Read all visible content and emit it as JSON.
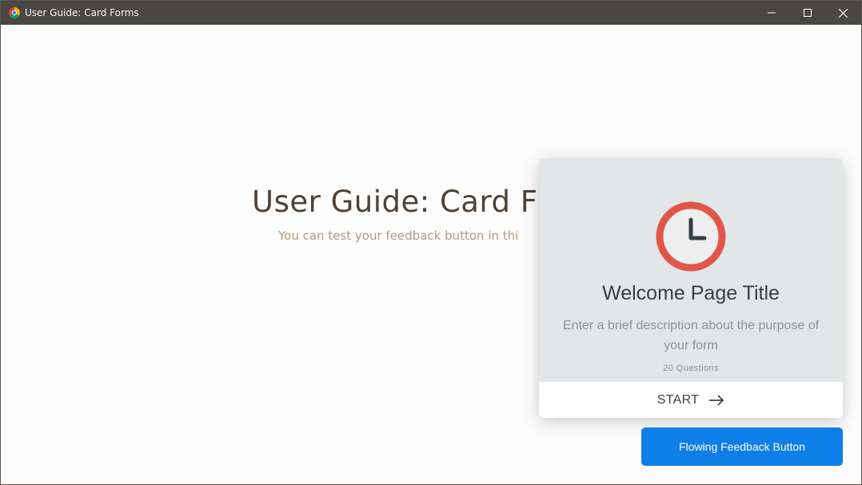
{
  "window": {
    "title": "User Guide: Card Forms",
    "app_icon": "chrome-icon",
    "controls": [
      "minimize-icon",
      "maximize-icon",
      "close-icon"
    ]
  },
  "page": {
    "title": "User Guide: Card F",
    "subtitle": "You can test your feedback button in thi"
  },
  "card": {
    "icon": "clock-icon",
    "title": "Welcome Page Title",
    "description": "Enter a brief description about the purpose of your form",
    "question_count": "20  Questions",
    "start_label": "START",
    "start_icon": "arrow-right-icon"
  },
  "feedback_button": {
    "label": "Flowing Feedback Button"
  },
  "colors": {
    "titlebar": "#494744",
    "card_bg": "#e2e6e7",
    "clock_ring": "#e0574a",
    "button": "#0f7ee8",
    "heading": "#4f4235",
    "subheading": "#b39a7c"
  }
}
